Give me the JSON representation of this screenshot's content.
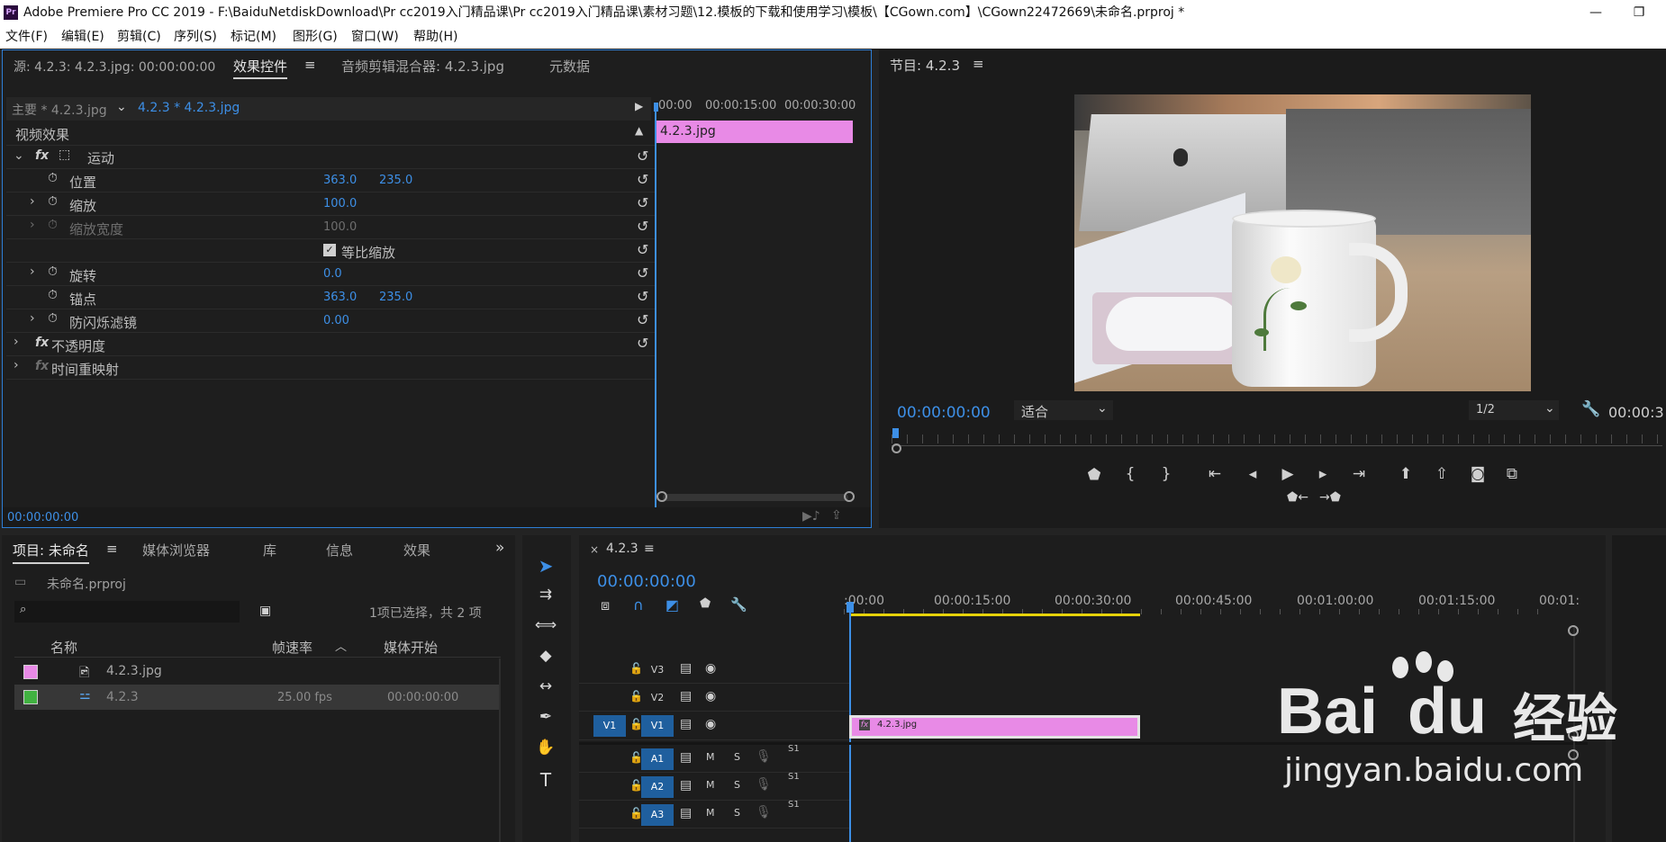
{
  "title_bar": {
    "logo": "Pr",
    "title": "Adobe Premiere Pro CC 2019 - F:\\BaiduNetdiskDownload\\Pr cc2019入门精品课\\Pr cc2019入门精品课\\素材习题\\12.模板的下载和使用学习\\模板\\【CGown.com】\\CGown22472669\\未命名.prproj *",
    "minimize": "—",
    "maximize": "❐"
  },
  "menu": [
    "文件(F)",
    "编辑(E)",
    "剪辑(C)",
    "序列(S)",
    "标记(M)",
    "图形(G)",
    "窗口(W)",
    "帮助(H)"
  ],
  "source_panel": {
    "tabs": [
      "源: 4.2.3: 4.2.3.jpg: 00:00:00:00",
      "效果控件",
      "音频剪辑混合器: 4.2.3.jpg",
      "元数据"
    ],
    "menu_icon": "≡",
    "master_label": "主要 * 4.2.3.jpg",
    "sequence_label": "4.2.3 * 4.2.3.jpg",
    "ruler": [
      "00:00",
      "00:00:15:00",
      "00:00:30:00"
    ],
    "clip_label": "4.2.3.jpg",
    "section": "视频效果",
    "effects": {
      "motion": "运动",
      "position": {
        "label": "位置",
        "x": "363.0",
        "y": "235.0"
      },
      "scale": {
        "label": "缩放",
        "value": "100.0"
      },
      "scale_width": {
        "label": "缩放宽度",
        "value": "100.0"
      },
      "uniform": "等比缩放",
      "rotation": {
        "label": "旋转",
        "value": "0.0"
      },
      "anchor": {
        "label": "锚点",
        "x": "363.0",
        "y": "235.0"
      },
      "flicker": {
        "label": "防闪烁滤镜",
        "value": "0.00"
      },
      "opacity": "不透明度",
      "time_remap": "时间重映射"
    },
    "fx": "fx",
    "timecode": "00:00:00:00"
  },
  "program_panel": {
    "title": "节目: 4.2.3",
    "menu_icon": "≡",
    "timecode": "00:00:00:00",
    "fit": "适合",
    "resolution": "1/2",
    "duration": "00:00:3"
  },
  "project_panel": {
    "tabs": [
      "项目: 未命名",
      "媒体浏览器",
      "库",
      "信息",
      "效果"
    ],
    "menu_icon": "≡",
    "more": "»",
    "project_file": "未命名.prproj",
    "selection": "1项已选择，共 2 项",
    "columns": [
      "名称",
      "帧速率",
      "媒体开始"
    ],
    "items": [
      {
        "name": "4.2.3.jpg",
        "fps": "",
        "start": "",
        "color": "#e88ae6"
      },
      {
        "name": "4.2.3",
        "fps": "25.00 fps",
        "start": "00:00:00:00",
        "color": "#41b241"
      }
    ]
  },
  "timeline": {
    "close": "×",
    "title": "4.2.3",
    "menu_icon": "≡",
    "timecode": "00:00:00:00",
    "ruler": [
      ":00:00",
      "00:00:15:00",
      "00:00:30:00",
      "00:00:45:00",
      "00:01:00:00",
      "00:01:15:00",
      "00:01:"
    ],
    "video_tracks": [
      "V3",
      "V2",
      "V1"
    ],
    "source_patch": "V1",
    "audio_tracks": [
      "A1",
      "A2",
      "A3"
    ],
    "m": "M",
    "s": "S",
    "audio_level": "S1",
    "clip": "4.2.3.jpg",
    "clip_fx": "fx",
    "clip_start_s": 0,
    "clip_end_s": 36
  },
  "watermark": {
    "brand": "Bai",
    "brand2": "du",
    "chinese": "经验",
    "url": "jingyan.baidu.com"
  },
  "colors": {
    "accent": "#3d8fe6",
    "clip": "#e88ae6",
    "workarea": "#e6d20a",
    "track_select": "#1f5f9e"
  }
}
